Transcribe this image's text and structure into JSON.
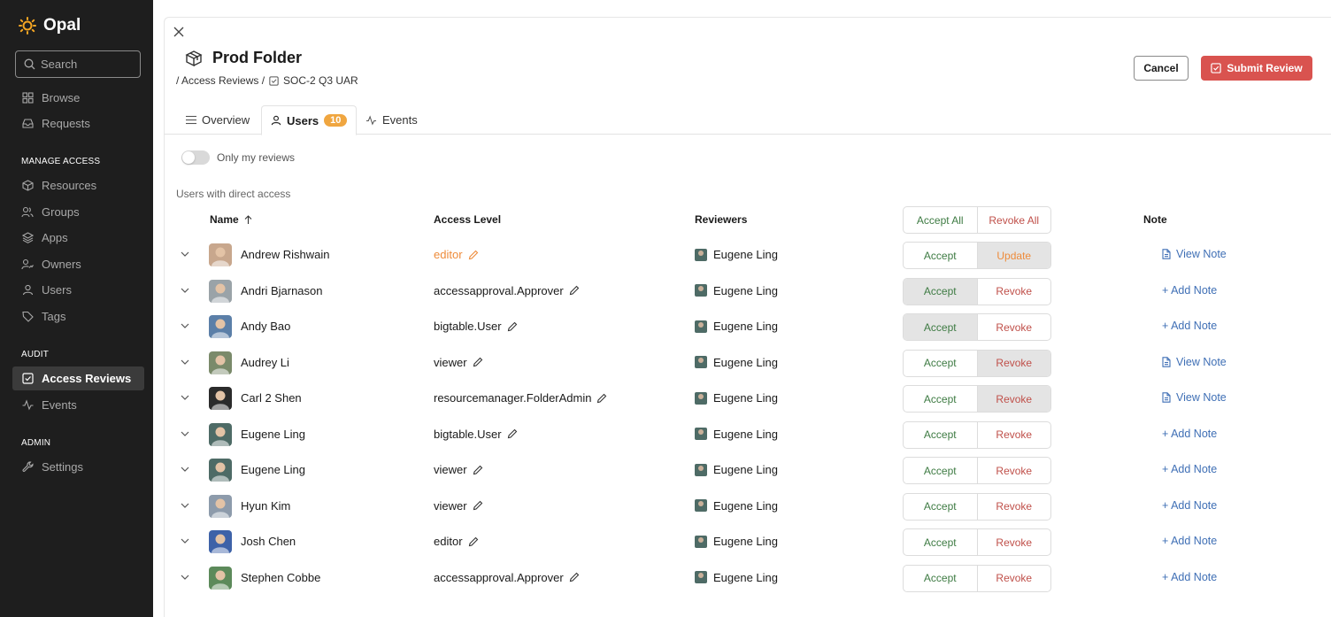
{
  "app": {
    "name": "Opal"
  },
  "sidebar": {
    "search_label": "Search",
    "top_items": [
      {
        "label": "Browse",
        "icon": "grid-icon"
      },
      {
        "label": "Requests",
        "icon": "inbox-icon"
      }
    ],
    "manage_label": "MANAGE ACCESS",
    "manage_items": [
      {
        "label": "Resources",
        "icon": "cube-icon"
      },
      {
        "label": "Groups",
        "icon": "group-icon"
      },
      {
        "label": "Apps",
        "icon": "layers-icon"
      },
      {
        "label": "Owners",
        "icon": "owner-icon"
      },
      {
        "label": "Users",
        "icon": "user-icon"
      },
      {
        "label": "Tags",
        "icon": "tag-icon"
      }
    ],
    "audit_label": "AUDIT",
    "audit_items": [
      {
        "label": "Access Reviews",
        "icon": "checkbox-icon",
        "active": true
      },
      {
        "label": "Events",
        "icon": "activity-icon"
      }
    ],
    "admin_label": "ADMIN",
    "admin_items": [
      {
        "label": "Settings",
        "icon": "wrench-icon"
      }
    ]
  },
  "header": {
    "title": "Prod Folder",
    "breadcrumb": [
      "/ Access Reviews /",
      "SOC-2 Q3 UAR"
    ],
    "cancel_label": "Cancel",
    "submit_label": "Submit Review"
  },
  "tabs": [
    {
      "label": "Overview",
      "active": false
    },
    {
      "label": "Users",
      "active": true,
      "count": "10"
    },
    {
      "label": "Events",
      "active": false
    }
  ],
  "filters": {
    "only_my_reviews_label": "Only my reviews"
  },
  "table": {
    "section_title": "Users with direct access",
    "headers": {
      "name": "Name",
      "access": "Access Level",
      "reviewers": "Reviewers",
      "note": "Note"
    },
    "bulk": {
      "accept_all": "Accept All",
      "revoke_all": "Revoke All"
    },
    "rows": [
      {
        "name": "Andrew Rishwain",
        "access": "editor",
        "access_changed": true,
        "reviewer": "Eugene Ling",
        "left": "Accept",
        "right": "Update",
        "selected": "right",
        "note": "View Note",
        "note_type": "view",
        "avatar_color": "#c8a78d"
      },
      {
        "name": "Andri Bjarnason",
        "access": "accessapproval.Approver",
        "access_changed": false,
        "reviewer": "Eugene Ling",
        "left": "Accept",
        "right": "Revoke",
        "selected": "left",
        "note": "+ Add Note",
        "note_type": "add",
        "avatar_color": "#9aa3a8"
      },
      {
        "name": "Andy Bao",
        "access": "bigtable.User",
        "access_changed": false,
        "reviewer": "Eugene Ling",
        "left": "Accept",
        "right": "Revoke",
        "selected": "left",
        "note": "+ Add Note",
        "note_type": "add",
        "avatar_color": "#5b7fa8"
      },
      {
        "name": "Audrey Li",
        "access": "viewer",
        "access_changed": false,
        "reviewer": "Eugene Ling",
        "left": "Accept",
        "right": "Revoke",
        "selected": "right",
        "note": "View Note",
        "note_type": "view",
        "avatar_color": "#7a8a6a"
      },
      {
        "name": "Carl 2 Shen",
        "access": "resourcemanager.FolderAdmin",
        "access_changed": false,
        "reviewer": "Eugene Ling",
        "left": "Accept",
        "right": "Revoke",
        "selected": "right",
        "note": "View Note",
        "note_type": "view",
        "avatar_color": "#2b2b2b"
      },
      {
        "name": "Eugene Ling",
        "access": "bigtable.User",
        "access_changed": false,
        "reviewer": "Eugene Ling",
        "left": "Accept",
        "right": "Revoke",
        "selected": "none",
        "note": "+ Add Note",
        "note_type": "add",
        "avatar_color": "#4e6b66"
      },
      {
        "name": "Eugene Ling",
        "access": "viewer",
        "access_changed": false,
        "reviewer": "Eugene Ling",
        "left": "Accept",
        "right": "Revoke",
        "selected": "none",
        "note": "+ Add Note",
        "note_type": "add",
        "avatar_color": "#4e6b66"
      },
      {
        "name": "Hyun Kim",
        "access": "viewer",
        "access_changed": false,
        "reviewer": "Eugene Ling",
        "left": "Accept",
        "right": "Revoke",
        "selected": "none",
        "note": "+ Add Note",
        "note_type": "add",
        "avatar_color": "#8d9bab"
      },
      {
        "name": "Josh Chen",
        "access": "editor",
        "access_changed": false,
        "reviewer": "Eugene Ling",
        "left": "Accept",
        "right": "Revoke",
        "selected": "none",
        "note": "+ Add Note",
        "note_type": "add",
        "avatar_color": "#3e62a8"
      },
      {
        "name": "Stephen Cobbe",
        "access": "accessapproval.Approver",
        "access_changed": false,
        "reviewer": "Eugene Ling",
        "left": "Accept",
        "right": "Revoke",
        "selected": "none",
        "note": "+ Add Note",
        "note_type": "add",
        "avatar_color": "#5c8a5a"
      }
    ]
  },
  "colors": {
    "sidebar_bg": "#1e1e1e",
    "submit": "#d9534f",
    "accept": "#3e7b43",
    "revoke": "#c0504a",
    "update": "#ee8b3a",
    "link": "#3f6fb5",
    "badge": "#f0a640"
  }
}
